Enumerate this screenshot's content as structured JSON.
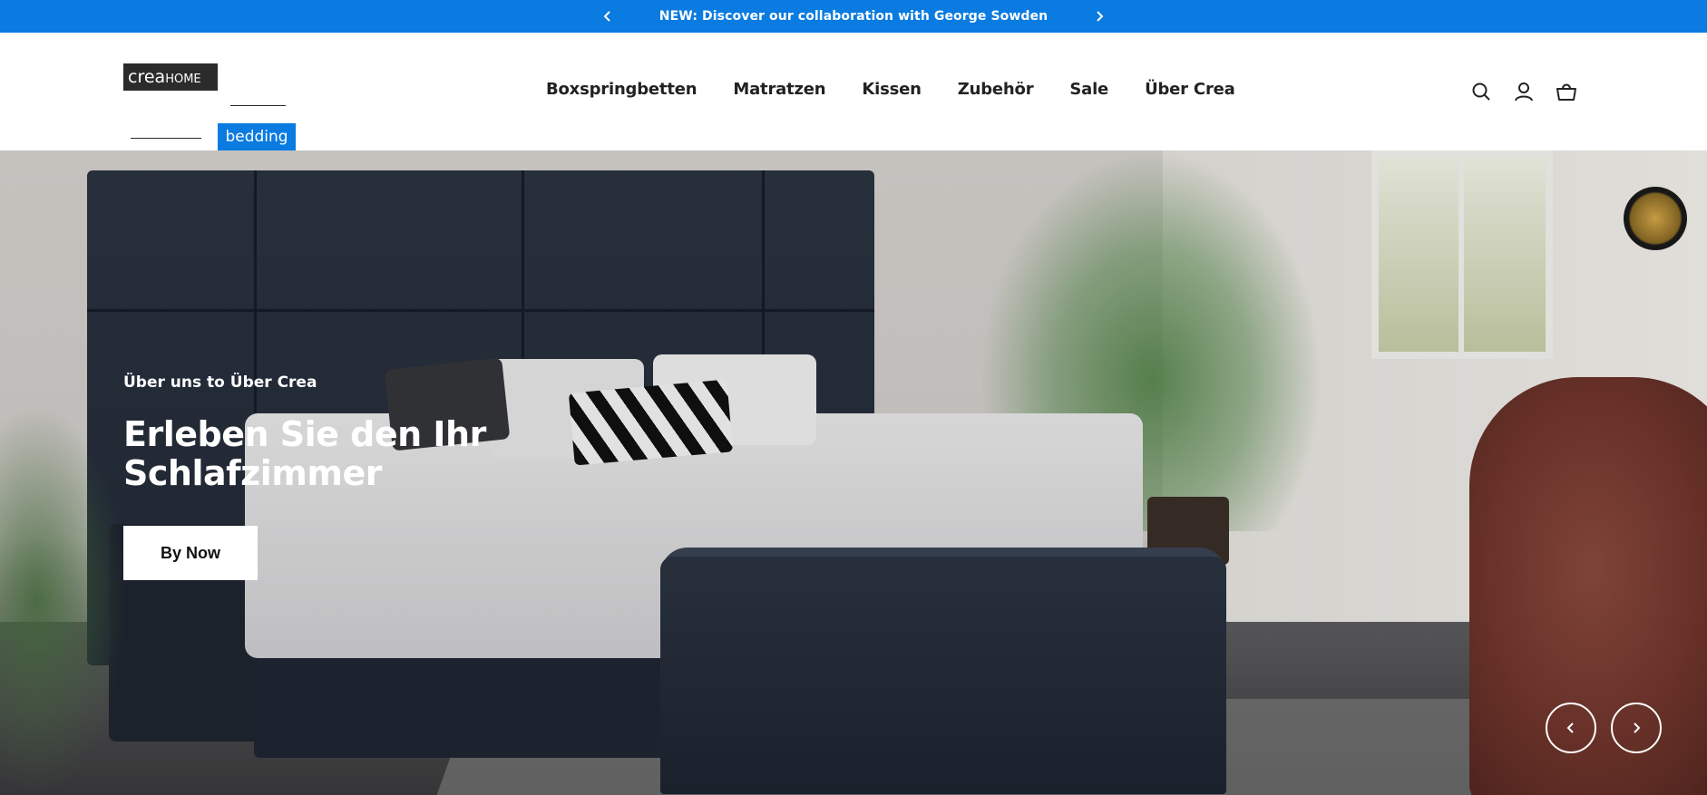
{
  "announcement": {
    "message": "NEW: Discover our collaboration with George Sowden",
    "background": "#0a7be0"
  },
  "logo": {
    "crea": "crea",
    "home": "HOME",
    "bedding": "bedding",
    "accent": "#0a7be0"
  },
  "nav": {
    "items": [
      "Boxspringbetten",
      "Matratzen",
      "Kissen",
      "Zubehör",
      "Sale",
      "Über Crea"
    ]
  },
  "header_icons": [
    "search-icon",
    "account-icon",
    "cart-icon"
  ],
  "hero": {
    "subheading": "Über uns to Über Crea",
    "title": "Erleben Sie den Ihr Schlafzimmer",
    "button_label": "By Now"
  }
}
